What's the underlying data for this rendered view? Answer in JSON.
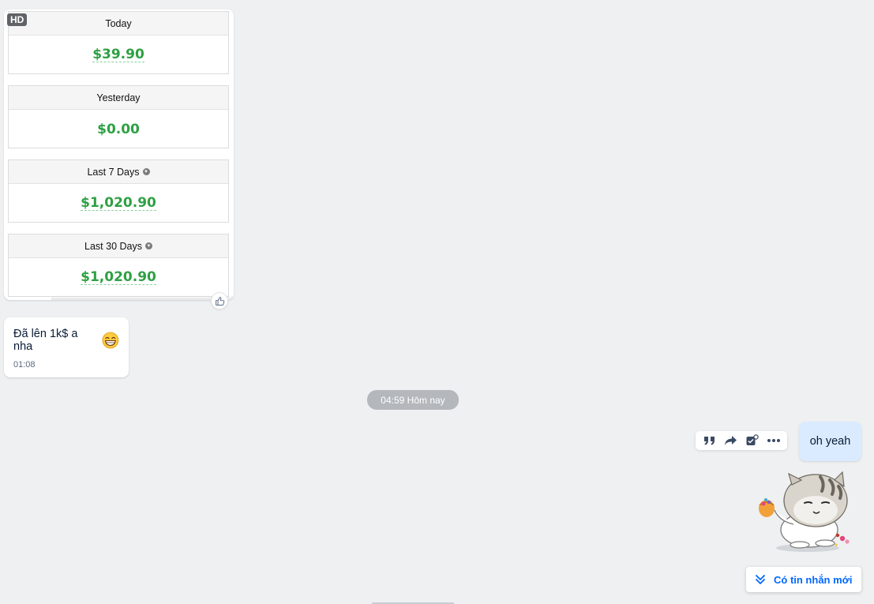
{
  "image_message": {
    "badge": "HD",
    "stats": [
      {
        "label": "Today",
        "value": "$39.90",
        "has_dropdown": false,
        "underlined": true
      },
      {
        "label": "Yesterday",
        "value": "$0.00",
        "has_dropdown": false,
        "underlined": false
      },
      {
        "label": "Last 7 Days",
        "value": "$1,020.90",
        "has_dropdown": true,
        "underlined": true
      },
      {
        "label": "Last 30 Days",
        "value": "$1,020.90",
        "has_dropdown": true,
        "underlined": true
      }
    ],
    "reaction_icon": "thumbs-up-icon"
  },
  "received_message": {
    "text": "Đã lên 1k$ a nha",
    "emoji": "grinning-face-icon",
    "time": "01:08"
  },
  "time_divider": "04:59 Hôm nay",
  "message_actions": [
    {
      "name": "quote-icon"
    },
    {
      "name": "forward-icon"
    },
    {
      "name": "task-icon"
    },
    {
      "name": "more-icon"
    }
  ],
  "sent_message": {
    "text": "oh yeah"
  },
  "sticker": {
    "icon": "cat-sticker-icon"
  },
  "new_messages_button": {
    "label": "Có tin nhắn mới",
    "icon": "double-chevron-down-icon"
  },
  "colors": {
    "background": "#eef0f1",
    "money_green": "#2ea043",
    "sent_bubble": "#dbebff",
    "link_blue": "#0068ff"
  }
}
